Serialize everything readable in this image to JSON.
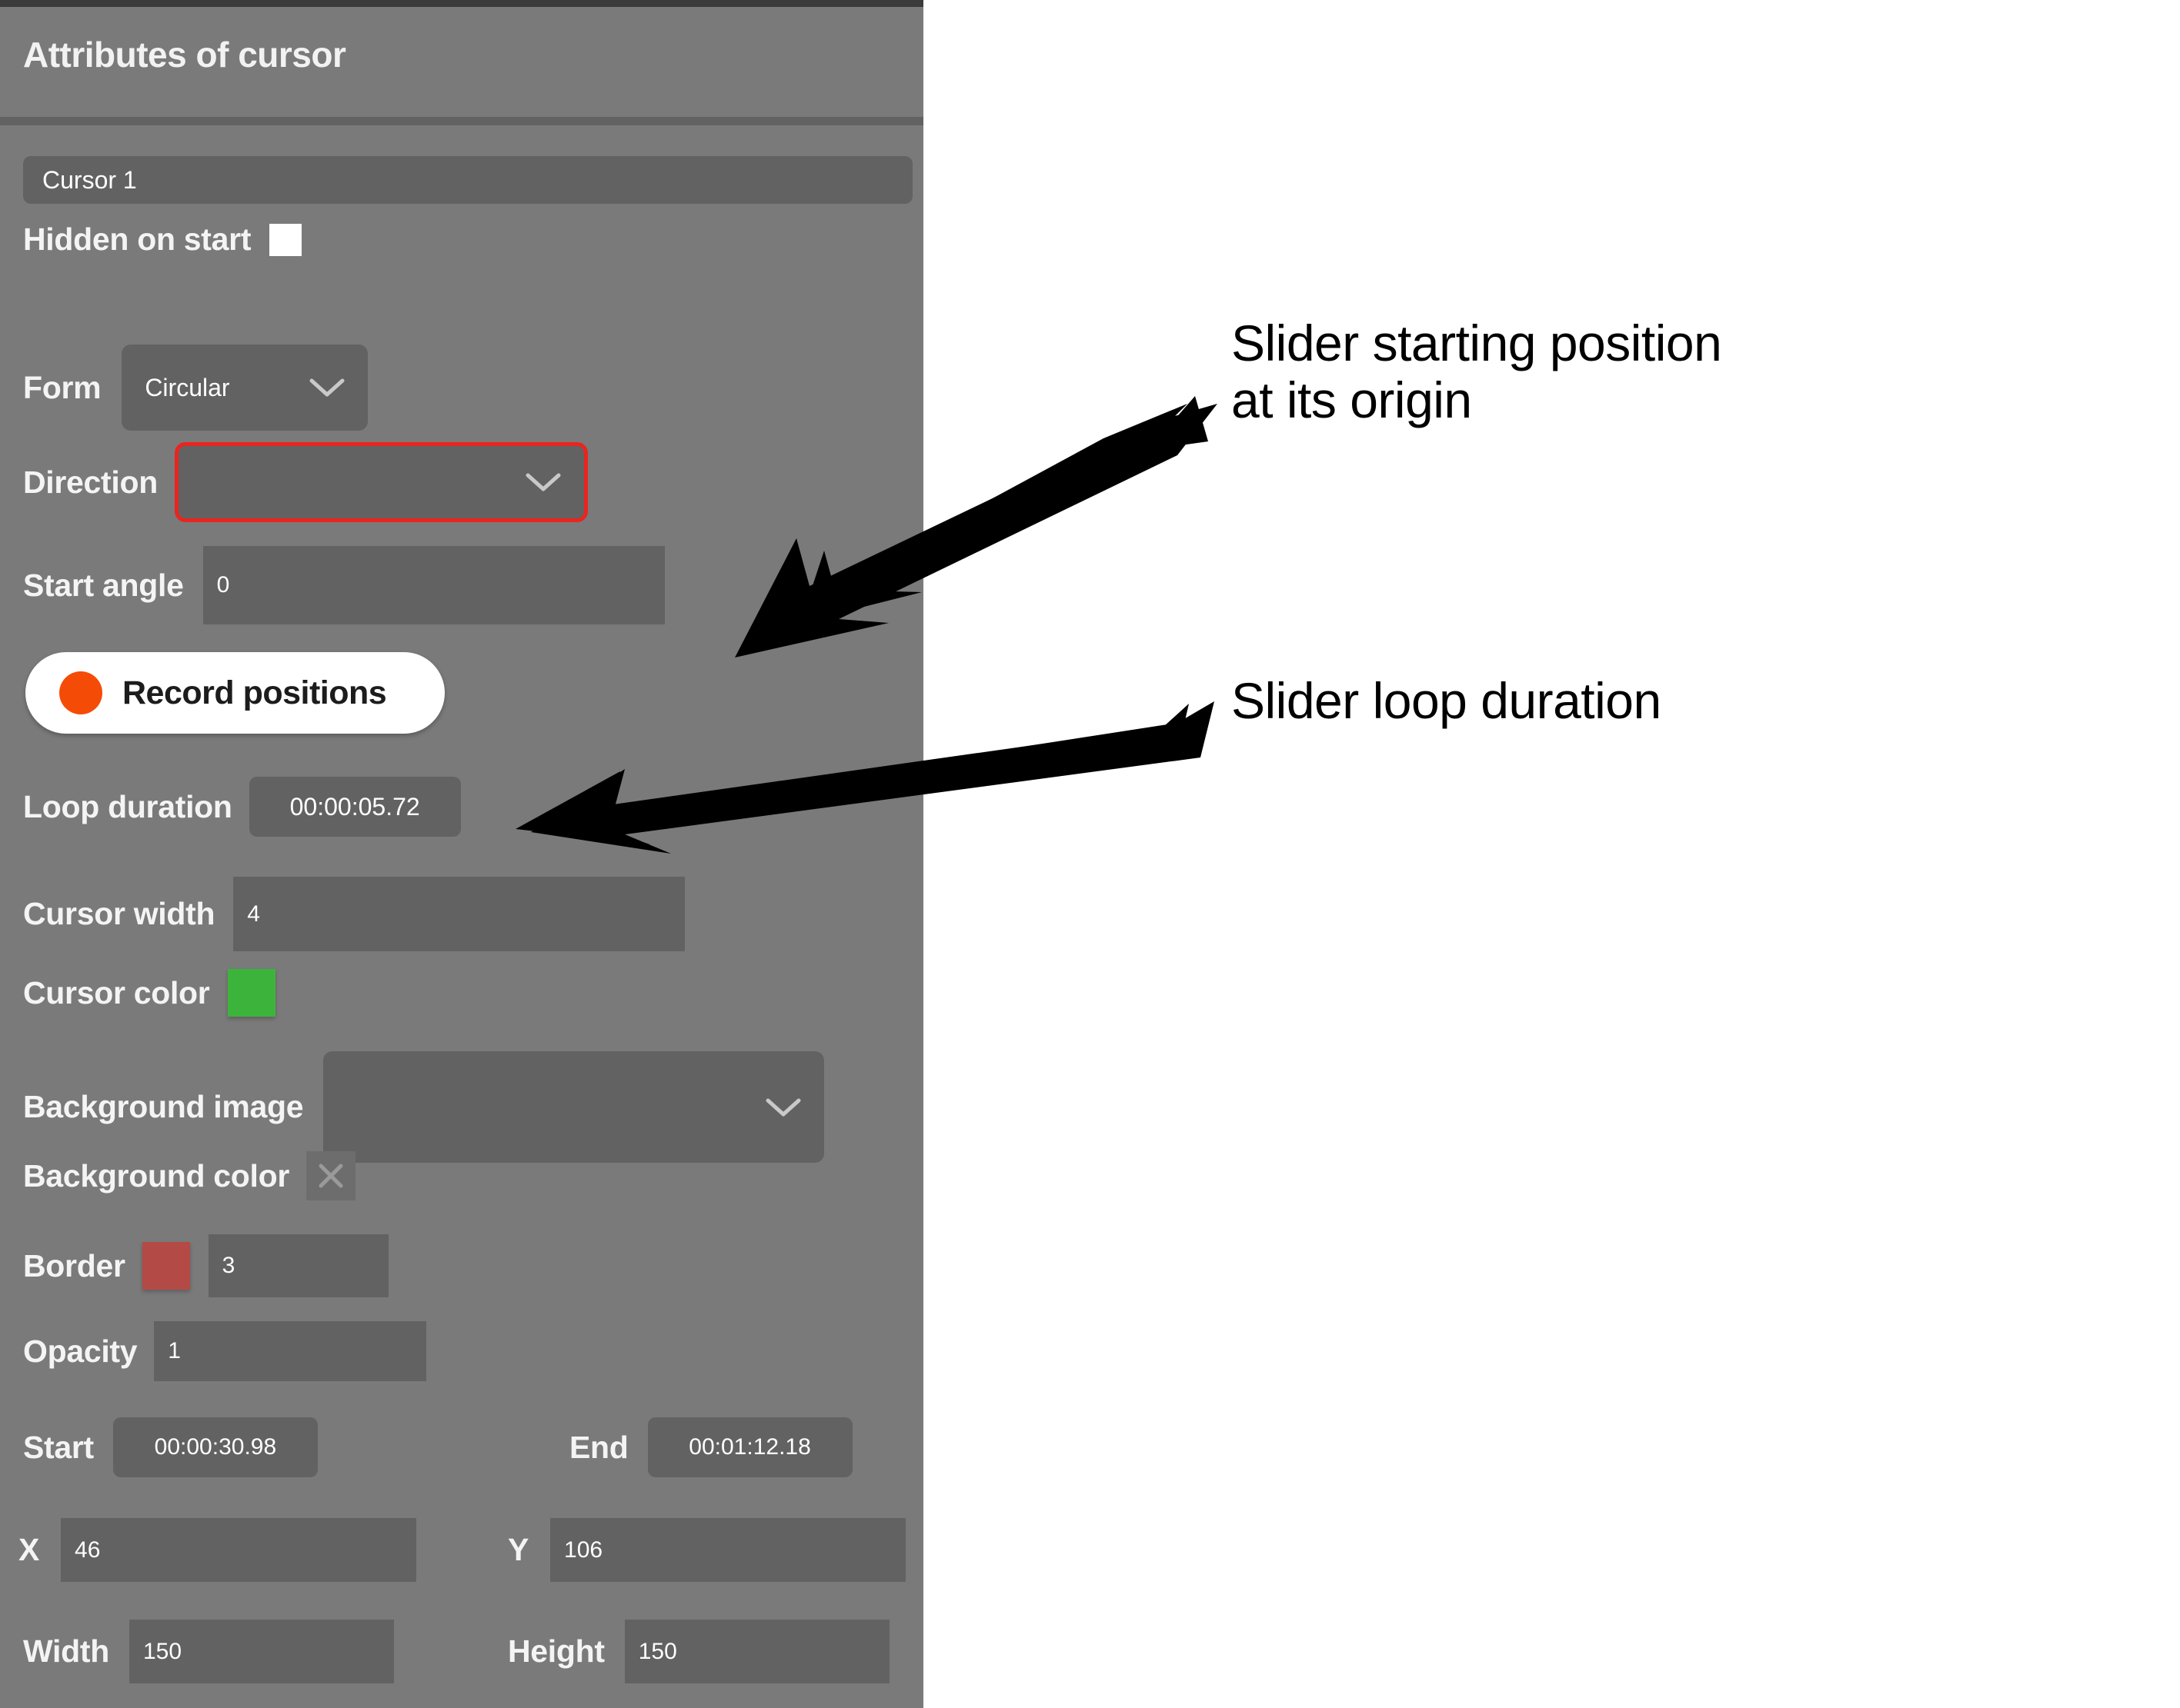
{
  "panel": {
    "title": "Attributes of cursor",
    "name_field": {
      "value": "Cursor 1"
    },
    "hidden_on_start": {
      "label": "Hidden on start",
      "checked": false
    },
    "form": {
      "label": "Form",
      "value": "Circular"
    },
    "direction": {
      "label": "Direction",
      "value": "",
      "invalid": true,
      "border_color": "#e8251f"
    },
    "start_angle": {
      "label": "Start angle",
      "value": "0"
    },
    "record_positions": {
      "label": "Record positions",
      "dot_color": "#f44c06"
    },
    "loop_duration": {
      "label": "Loop duration",
      "value": "00:00:05.72"
    },
    "cursor_width": {
      "label": "Cursor width",
      "value": "4"
    },
    "cursor_color": {
      "label": "Cursor color",
      "value": "#3cb43c"
    },
    "background_image": {
      "label": "Background image",
      "value": ""
    },
    "background_color": {
      "label": "Background color",
      "clear_icon": "close-x-icon"
    },
    "border": {
      "label": "Border",
      "color": "#b44a46",
      "value": "3"
    },
    "opacity": {
      "label": "Opacity",
      "value": "1"
    },
    "start": {
      "label": "Start",
      "value": "00:00:30.98"
    },
    "end": {
      "label": "End",
      "value": "00:01:12.18"
    },
    "x": {
      "label": "X",
      "value": "46"
    },
    "y": {
      "label": "Y",
      "value": "106"
    },
    "width": {
      "label": "Width",
      "value": "150"
    },
    "height": {
      "label": "Height",
      "value": "150"
    }
  },
  "annotations": [
    {
      "text": "Slider starting position\nat its origin",
      "target": "start-angle-field"
    },
    {
      "text": "Slider loop duration",
      "target": "loop-duration-field"
    }
  ],
  "colors": {
    "panel_bg": "#7a7a7a",
    "field_bg": "#626262",
    "page_bg": "#ffffff",
    "text": "#f4f4f4",
    "accent_error": "#e8251f",
    "record_dot": "#f44c06",
    "cursor_green": "#3cb43c",
    "border_red": "#b44a46"
  }
}
